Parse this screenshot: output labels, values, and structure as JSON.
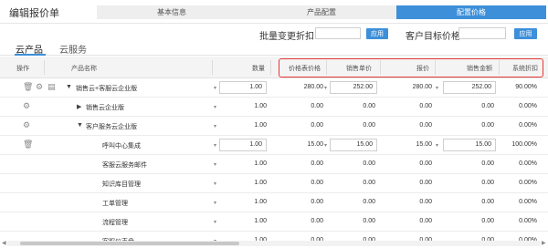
{
  "page": {
    "title": "编辑报价单"
  },
  "steps": [
    {
      "label": "基本信息",
      "active": false
    },
    {
      "label": "产品配置",
      "active": false
    },
    {
      "label": "配置价格",
      "active": true
    }
  ],
  "toolbar": {
    "batch_discount_label": "批量变更折扣",
    "batch_discount_value": "",
    "apply_button": "应用",
    "target_price_label": "客户目标价格",
    "target_price_value": "",
    "apply_button_2": "应用"
  },
  "tabs": [
    {
      "label": "云产品",
      "active": true
    },
    {
      "label": "云服务",
      "active": false
    }
  ],
  "columns": {
    "op": "操作",
    "name": "产品名称",
    "qty": "数量",
    "list_price": "价格表价格",
    "unit_price": "销售单价",
    "amount": "报价",
    "sales_amount": "销售金额",
    "discount": "系统折扣"
  },
  "rows": [
    {
      "name": "销售云+客服云企业版",
      "qty": "1.00",
      "list_price": "280.00",
      "unit_price": "252.00",
      "amount": "280.00",
      "sales_amount": "252.00",
      "discount": "90.00%"
    },
    {
      "name": "销售云企业版",
      "qty": "1.00",
      "list_price": "0.00",
      "unit_price": "0.00",
      "amount": "0.00",
      "sales_amount": "0.00",
      "discount": "0.00%"
    },
    {
      "name": "客户服务云企业版",
      "qty": "1.00",
      "list_price": "0.00",
      "unit_price": "0.00",
      "amount": "0.00",
      "sales_amount": "0.00",
      "discount": "0.00%"
    },
    {
      "name": "呼叫中心集成",
      "qty": "1.00",
      "list_price": "15.00",
      "unit_price": "15.00",
      "amount": "15.00",
      "sales_amount": "15.00",
      "discount": "100.00%"
    },
    {
      "name": "客服云服务邮件",
      "qty": "1.00",
      "list_price": "0.00",
      "unit_price": "0.00",
      "amount": "0.00",
      "sales_amount": "0.00",
      "discount": "0.00%"
    },
    {
      "name": "知识库目管理",
      "qty": "1.00",
      "list_price": "0.00",
      "unit_price": "0.00",
      "amount": "0.00",
      "sales_amount": "0.00",
      "discount": "0.00%"
    },
    {
      "name": "工单管理",
      "qty": "1.00",
      "list_price": "0.00",
      "unit_price": "0.00",
      "amount": "0.00",
      "sales_amount": "0.00",
      "discount": "0.00%"
    },
    {
      "name": "流程管理",
      "qty": "1.00",
      "list_price": "0.00",
      "unit_price": "0.00",
      "amount": "0.00",
      "sales_amount": "0.00",
      "discount": "0.00%"
    },
    {
      "name": "客服仪表盘",
      "qty": "1.00",
      "list_price": "0.00",
      "unit_price": "0.00",
      "amount": "0.00",
      "sales_amount": "0.00",
      "discount": "0.00%"
    }
  ]
}
